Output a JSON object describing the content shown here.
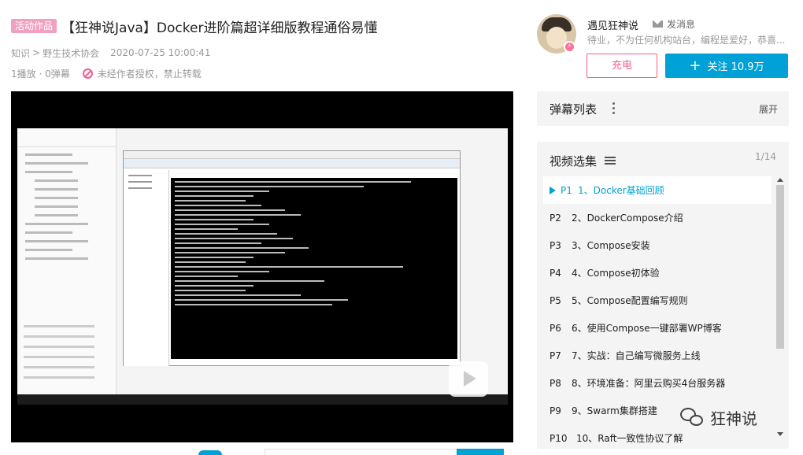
{
  "video": {
    "badge": "活动作品",
    "title": "【狂神说Java】Docker进阶篇超详细版教程通俗易懂",
    "category": "知识",
    "subcategory": "野生技术协会",
    "breadcrumb_sep": ">",
    "pubdate": "2020-07-25 10:00:41",
    "stats": "1播放 · 0弹幕",
    "copyright": "未经作者授权，禁止转载"
  },
  "up": {
    "name": "遇见狂神说",
    "message": "发消息",
    "description": "待业，不为任何机构站台，编程是爱好，恭喜...",
    "charge": "充电",
    "follow": "关注 10.9万"
  },
  "danmaku": {
    "title": "弹幕列表",
    "expand": "展开"
  },
  "episodes": {
    "title": "视频选集",
    "page": "1/14",
    "items": [
      {
        "p": "P1",
        "name": "1、Docker基础回顾",
        "active": true
      },
      {
        "p": "P2",
        "name": "2、DockerCompose介绍"
      },
      {
        "p": "P3",
        "name": "3、Compose安装"
      },
      {
        "p": "P4",
        "name": "4、Compose初体验"
      },
      {
        "p": "P5",
        "name": "5、Compose配置编写规则"
      },
      {
        "p": "P6",
        "name": "6、使用Compose一键部署WP博客"
      },
      {
        "p": "P7",
        "name": "7、实战：自己编写微服务上线"
      },
      {
        "p": "P8",
        "name": "8、环境准备：阿里云购买4台服务器"
      },
      {
        "p": "P9",
        "name": "9、Swarm集群搭建"
      },
      {
        "p": "P10",
        "name": "10、Raft一致性协议了解"
      }
    ]
  },
  "watermark": "狂神说",
  "colors": {
    "accent_blue": "#00a1d6",
    "accent_pink": "#f25d8e",
    "badge_pink": "#f0a0c0"
  }
}
